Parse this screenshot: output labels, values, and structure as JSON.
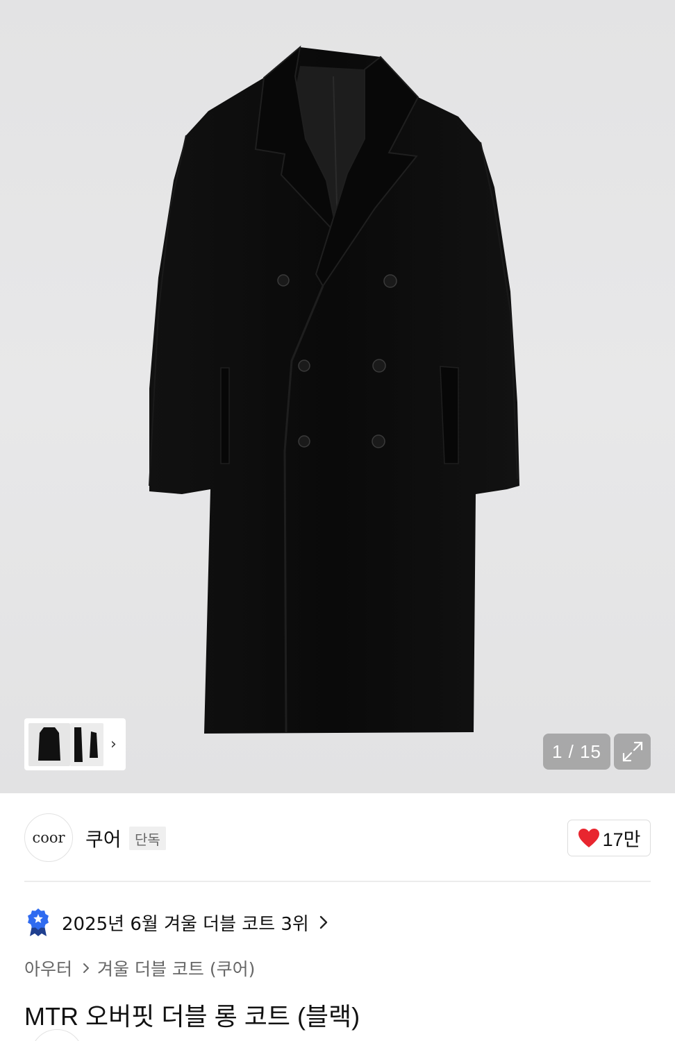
{
  "gallery": {
    "counter": "1 / 15",
    "thumbnail_next": "›"
  },
  "brand": {
    "logo_text": "coor",
    "name": "쿠어",
    "badge": "단독",
    "likes": "17만"
  },
  "ranking": {
    "text": "2025년 6월 겨울 더블 코트 3위"
  },
  "breadcrumb": [
    "아우터",
    "겨울 더블 코트 (쿠어)"
  ],
  "product": {
    "title": "MTR 오버핏 더블 롱 코트 (블랙)"
  },
  "colors": {
    "like_heart": "#e8262f",
    "rank_badge": "#2f6bf0",
    "coat": "#0d0d0d"
  }
}
